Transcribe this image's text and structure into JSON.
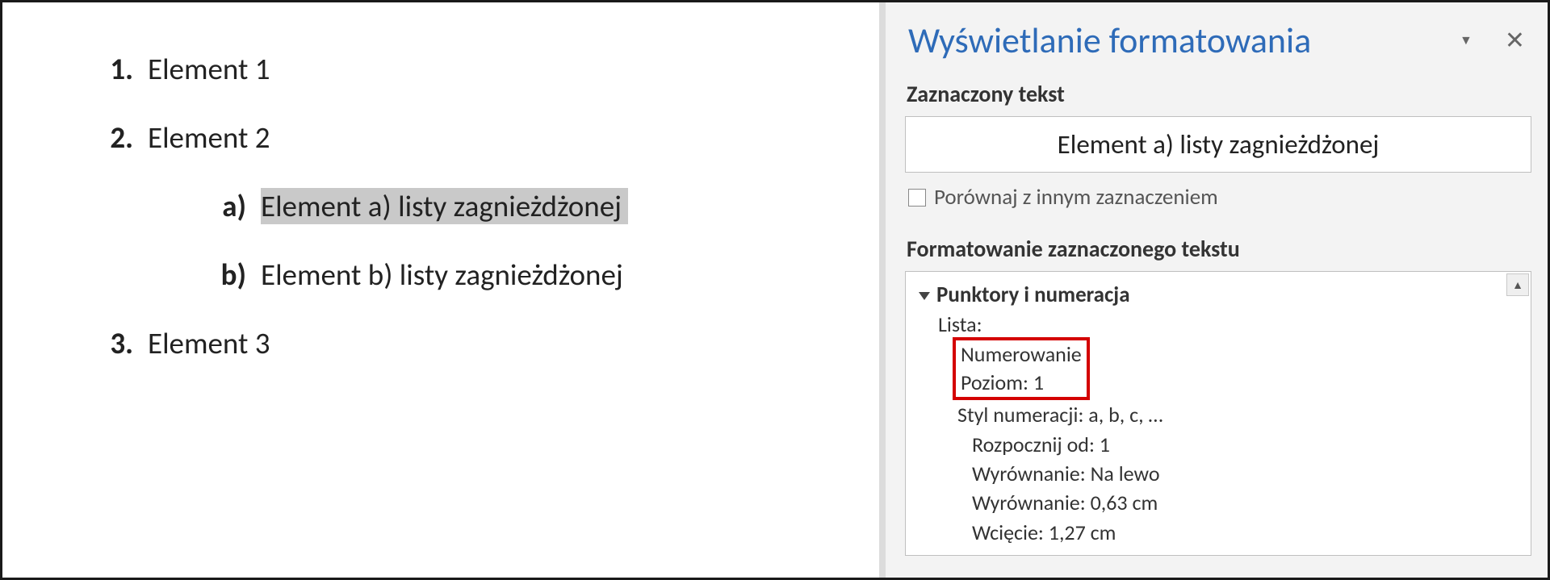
{
  "doc": {
    "items": [
      {
        "num": "1.",
        "text": "Element 1"
      },
      {
        "num": "2.",
        "text": "Element 2"
      },
      {
        "num": "a)",
        "text": "Element a) listy zagnieżdżonej"
      },
      {
        "num": "b)",
        "text": "Element b) listy zagnieżdżonej"
      },
      {
        "num": "3.",
        "text": "Element 3"
      }
    ]
  },
  "pane": {
    "title": "Wyświetlanie formatowania",
    "selected_label": "Zaznaczony tekst",
    "selected_text": "Element a) listy zagnieżdżonej",
    "compare_label": "Porównaj z innym zaznaczeniem",
    "fmt_label": "Formatowanie zaznaczonego tekstu",
    "bullets_heading": "Punktory i numeracja",
    "lista_label": "Lista:",
    "numerowanie": "Numerowanie",
    "poziom": "Poziom: 1",
    "styl": "Styl numeracji:   a, b, c, …",
    "rozpocznij": "Rozpocznij od: 1",
    "wyrownanie1": "Wyrównanie: Na lewo",
    "wyrownanie2": "Wyrównanie:  0,63 cm",
    "wciecie": "Wcięcie:  1,27 cm"
  }
}
